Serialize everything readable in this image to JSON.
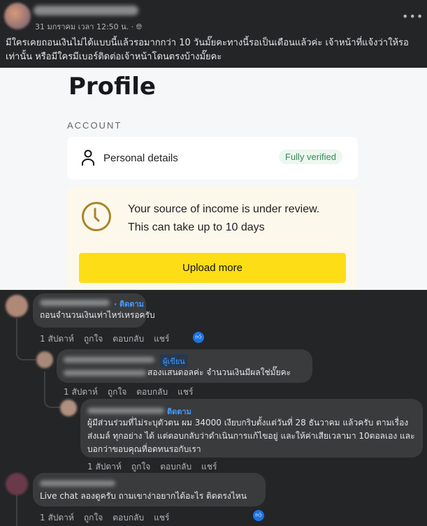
{
  "post": {
    "date": "31 มกราคม เวลา 12:50 น. ·",
    "privacy_icon": "globe-icon",
    "text": "มีใครเคยถอนเงินไม่ได้แบบนี้แล้วรอมากกว่า 10 วันมั๊ยคะทางนี้รอเป็นเดือนแล้วค่ะ เจ้าหน้าที่แจ้งว่าให้รอเท่านั้น หรือมีใครมีเบอร์ติดต่อเจ้าหน้าโดนตรงบ้างมั๊ยคะ",
    "more": "•••"
  },
  "screenshot": {
    "title": "Profile",
    "section": "ACCOUNT",
    "personal_details": "Personal details",
    "badge": "Fully verified",
    "review_line1": "Your source of income is under review.",
    "review_line2": "This can take up to 10 days",
    "upload": "Upload more",
    "colors": {
      "button": "#fddd16",
      "clock": "#a7862b",
      "badge": "#3d8a58"
    }
  },
  "actions": {
    "time": "1 สัปดาห์",
    "like": "ถูกใจ",
    "reply": "ตอบกลับ",
    "share": "แชร์"
  },
  "comments": [
    {
      "badge": "· ติดตาม",
      "text": "ถอนจำนวนเงินเท่าไหร่เหรอครับ"
    },
    {
      "badge": "ผู้เขียน",
      "text": "สองแสนดอลค่ะ จำนวนเงินมีผลใช่มั๊ยคะ"
    },
    {
      "badge": "ติดตาม",
      "text": "ผู้มีส่วนร่วมที่ไม่ระบุตัวตน ผม 34000 เงียบกริบตั้งแต่วันที่ 28 ธันวาคม แล้วครับ ตามเรื่อง ส่งเมล์ ทุกอย่าง ได้ แต่ตอบกลับว่าดำเนินการแก้ไขอยู่ และให้ค่าเสียเวลามา 10ดอลเอง และบอกว่าขอบคุณที่อดทนรอกับเรา"
    },
    {
      "text": "Live chat ลองดูครับ ถามเขาง่าอยากได้อะไร ติดตรงไหน"
    }
  ]
}
